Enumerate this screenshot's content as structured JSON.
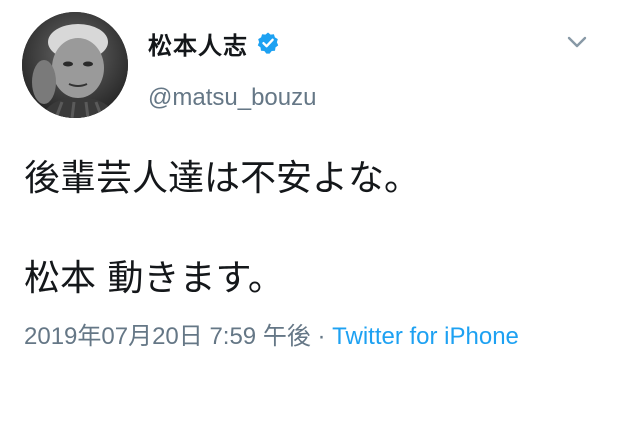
{
  "tweet": {
    "display_name": "松本人志",
    "handle": "@matsu_bouzu",
    "verified_icon": "verified-badge-icon",
    "menu_icon": "chevron-down-icon",
    "body_line_1": "後輩芸人達は不安よな。",
    "body_line_2": "松本 動きます。",
    "timestamp": "2019年07月20日 7:59 午後",
    "separator": " · ",
    "source": "Twitter for iPhone"
  },
  "colors": {
    "text": "#14171a",
    "muted": "#657786",
    "link": "#1da1f2",
    "verified": "#1da1f2"
  }
}
